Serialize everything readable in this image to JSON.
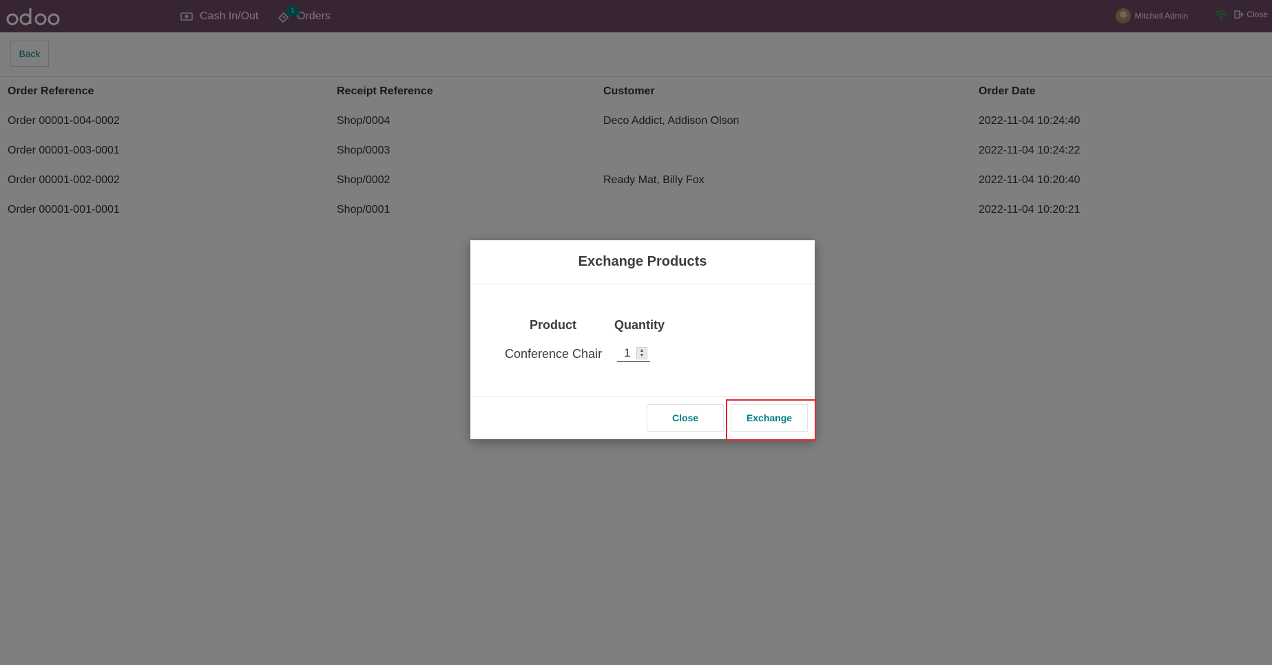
{
  "topbar": {
    "logo_text": "odoo",
    "nav": [
      {
        "label": "Cash In/Out",
        "icon": "cash-icon"
      },
      {
        "label": "Orders",
        "icon": "ticket-icon",
        "badge": "1"
      }
    ],
    "user_name": "Mitchell Admin",
    "close_label": "Close"
  },
  "controls": {
    "back_label": "Back"
  },
  "table": {
    "headers": [
      "Order Reference",
      "Receipt Reference",
      "Customer",
      "Order Date"
    ],
    "rows": [
      [
        "Order 00001-004-0002",
        "Shop/0004",
        "Deco Addict, Addison Olson",
        "2022-11-04 10:24:40"
      ],
      [
        "Order 00001-003-0001",
        "Shop/0003",
        "",
        "2022-11-04 10:24:22"
      ],
      [
        "Order 00001-002-0002",
        "Shop/0002",
        "Ready Mat, Billy Fox",
        "2022-11-04 10:20:40"
      ],
      [
        "Order 00001-001-0001",
        "Shop/0001",
        "",
        "2022-11-04 10:20:21"
      ]
    ]
  },
  "modal": {
    "title": "Exchange Products",
    "col_product": "Product",
    "col_quantity": "Quantity",
    "item": {
      "product": "Conference Chair",
      "quantity": "1"
    },
    "close_label": "Close",
    "exchange_label": "Exchange"
  },
  "colors": {
    "topbar": "#714b67",
    "accent": "#017e84",
    "highlight": "#e4282e"
  }
}
